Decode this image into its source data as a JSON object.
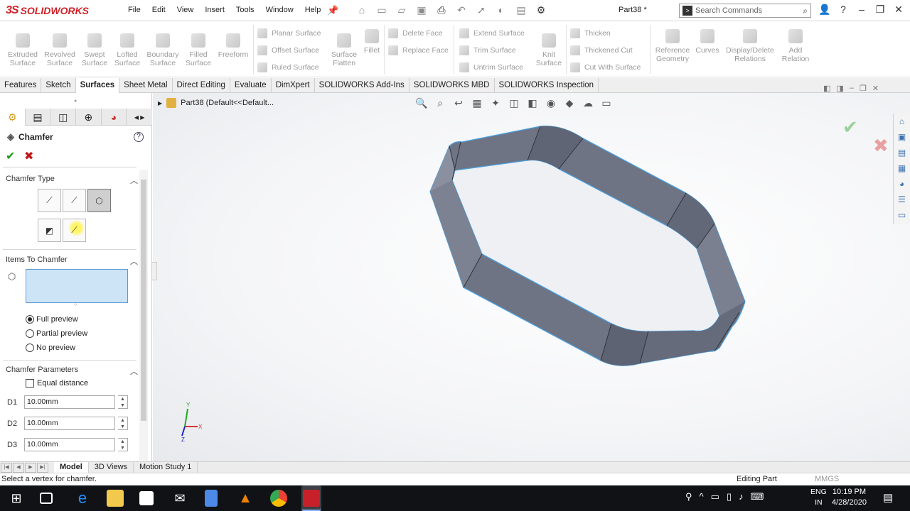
{
  "app": {
    "logo_text": "SOLIDWORKS",
    "logo_mark": "3S",
    "document_title": "Part38 *"
  },
  "menu": [
    "File",
    "Edit",
    "View",
    "Insert",
    "Tools",
    "Window",
    "Help"
  ],
  "search": {
    "placeholder": "Search Commands"
  },
  "commands": {
    "big": [
      "Extruded Surface",
      "Revolved Surface",
      "Swept Surface",
      "Lofted Surface",
      "Boundary Surface",
      "Filled Surface",
      "Freeform"
    ],
    "group1": [
      "Planar Surface",
      "Offset Surface",
      "Ruled Surface"
    ],
    "surface_flatten": "Surface Flatten",
    "fillet": "Fillet",
    "group2": [
      "Delete Face",
      "Replace Face"
    ],
    "group3": [
      "Extend Surface",
      "Trim Surface",
      "Untrim Surface"
    ],
    "knit_surface": "Knit Surface",
    "group4": [
      "Thicken",
      "Thickened Cut",
      "Cut With Surface"
    ],
    "reference_geometry": "Reference Geometry",
    "curves": "Curves",
    "display_delete_relations": "Display/Delete Relations",
    "add_relation": "Add Relation"
  },
  "tabs": [
    "Features",
    "Sketch",
    "Surfaces",
    "Sheet Metal",
    "Direct Editing",
    "Evaluate",
    "DimXpert",
    "SOLIDWORKS Add-Ins",
    "SOLIDWORKS MBD",
    "SOLIDWORKS Inspection"
  ],
  "active_tab": "Surfaces",
  "property_manager": {
    "title": "Chamfer",
    "sections": {
      "chamfer_type": "Chamfer Type",
      "items_to_chamfer": "Items To Chamfer",
      "chamfer_parameters": "Chamfer Parameters"
    },
    "preview_options": [
      "Full preview",
      "Partial preview",
      "No preview"
    ],
    "selected_preview": "Full preview",
    "equal_distance_label": "Equal distance",
    "equal_distance_checked": false,
    "distances": [
      "10.00mm",
      "10.00mm",
      "10.00mm"
    ],
    "distance_icons": [
      "D1",
      "D2",
      "D3"
    ]
  },
  "feature_tree": {
    "item": "Part38  (Default<<Default..."
  },
  "bottom_tabs": [
    "Model",
    "3D Views",
    "Motion Study 1"
  ],
  "active_bottom_tab": "Model",
  "status": {
    "message": "Select a vertex for chamfer.",
    "mode": "Editing Part",
    "units": "MMGS"
  },
  "taskbar": {
    "time": "10:19 PM",
    "date": "4/28/2020",
    "lang": "ENG",
    "region": "IN"
  },
  "colors": {
    "model_fill": "#6e7484",
    "model_edge": "#4aa0e0",
    "accent": "#d02027",
    "taskbar": "#101216"
  }
}
